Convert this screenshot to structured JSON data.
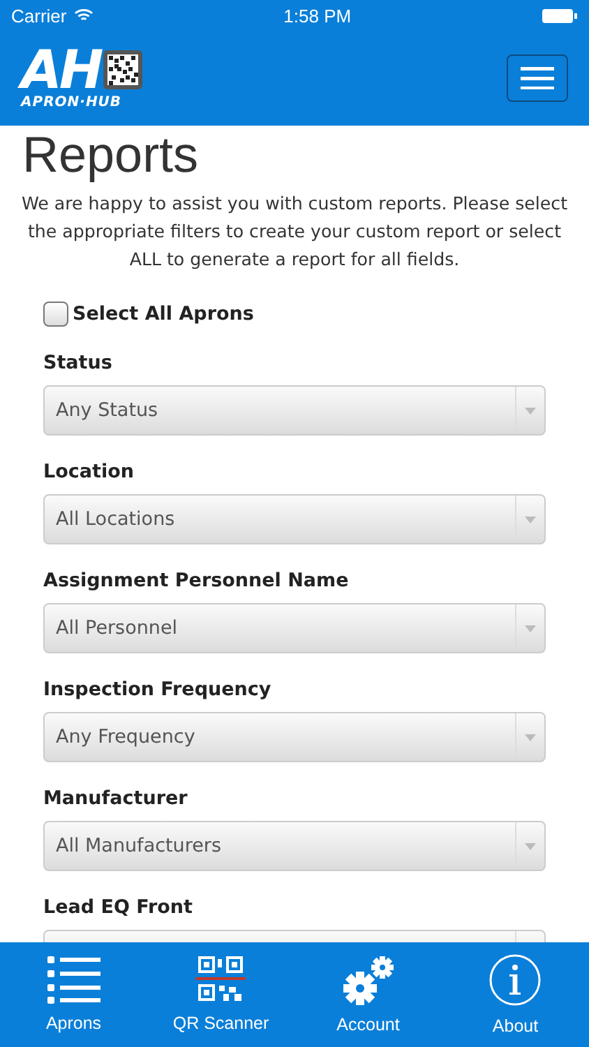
{
  "status_bar": {
    "carrier": "Carrier",
    "time": "1:58 PM"
  },
  "header": {
    "logo": {
      "mark": "AH",
      "wordmark": "APRON·HUB"
    }
  },
  "page": {
    "title": "Reports",
    "intro": "We are happy to assist you with custom reports. Please select the appropriate filters to create your custom report or select ALL to generate a report for all fields."
  },
  "select_all": {
    "label": "Select All Aprons",
    "checked": false
  },
  "filters": [
    {
      "label": "Status",
      "value": "Any Status"
    },
    {
      "label": "Location",
      "value": "All Locations"
    },
    {
      "label": "Assignment Personnel Name",
      "value": "All Personnel"
    },
    {
      "label": "Inspection Frequency",
      "value": "Any Frequency"
    },
    {
      "label": "Manufacturer",
      "value": "All Manufacturers"
    },
    {
      "label": "Lead EQ Front"
    }
  ],
  "tab_bar": [
    {
      "kind": "list",
      "label": "Aprons"
    },
    {
      "kind": "qr",
      "label": "QR Scanner"
    },
    {
      "kind": "gears",
      "label": "Account"
    },
    {
      "kind": "info",
      "label": "About"
    }
  ]
}
